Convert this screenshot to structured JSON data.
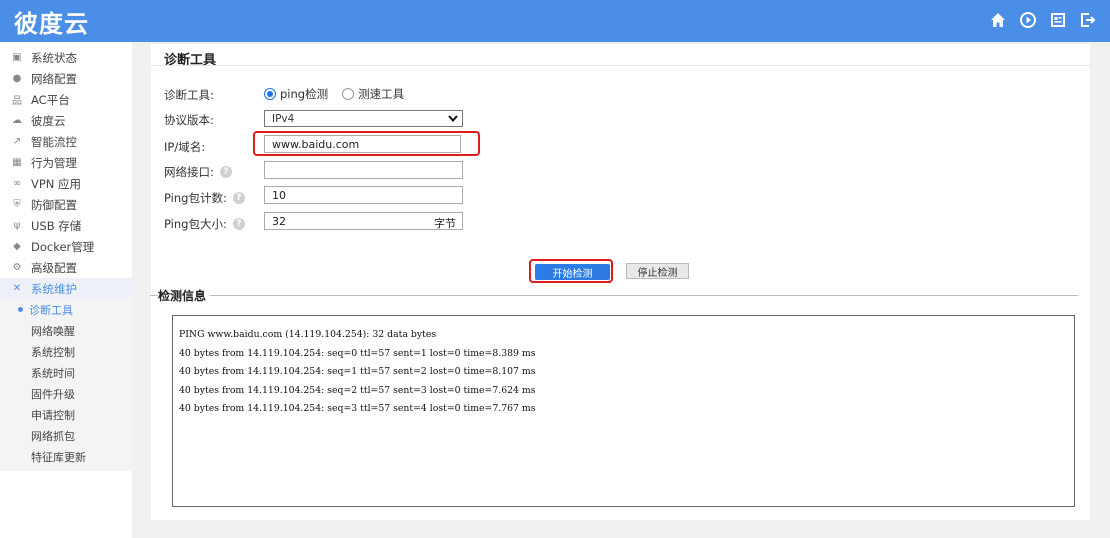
{
  "header": {
    "logo_text": "彼度云",
    "icons": [
      "home-icon",
      "play-circle-icon",
      "panel-icon",
      "logout-icon"
    ]
  },
  "sidebar": {
    "items": [
      {
        "label": "系统状态",
        "icon": "monitor-icon"
      },
      {
        "label": "网络配置",
        "icon": "globe-icon"
      },
      {
        "label": "AC平台",
        "icon": "network-tree-icon"
      },
      {
        "label": "彼度云",
        "icon": "cloud-icon"
      },
      {
        "label": "智能流控",
        "icon": "trend-icon"
      },
      {
        "label": "行为管理",
        "icon": "chart-box-icon"
      },
      {
        "label": "VPN 应用",
        "icon": "vpn-icon"
      },
      {
        "label": "防御配置",
        "icon": "shield-icon"
      },
      {
        "label": "USB 存储",
        "icon": "usb-icon"
      },
      {
        "label": "Docker管理",
        "icon": "docker-icon"
      },
      {
        "label": "高级配置",
        "icon": "gear-icon"
      },
      {
        "label": "系统维护",
        "icon": "tools-icon"
      }
    ],
    "sub_items": [
      {
        "label": "诊断工具"
      },
      {
        "label": "网络唤醒"
      },
      {
        "label": "系统控制"
      },
      {
        "label": "系统时间"
      },
      {
        "label": "固件升级"
      },
      {
        "label": "申请控制"
      },
      {
        "label": "网络抓包"
      },
      {
        "label": "特征库更新"
      }
    ]
  },
  "main": {
    "title": "诊断工具",
    "form": {
      "tool_label": "诊断工具:",
      "tool_options": [
        "ping检测",
        "测速工具"
      ],
      "tool_selected": "ping检测",
      "protocol_label": "协议版本:",
      "protocol_value": "IPv4",
      "ip_label": "IP/域名:",
      "ip_value": "www.baidu.com",
      "iface_label": "网络接口:",
      "iface_value": "",
      "count_label": "Ping包计数:",
      "count_value": "10",
      "size_label": "Ping包大小:",
      "size_value": "32",
      "size_unit": "字节"
    },
    "buttons": {
      "start": "开始检测",
      "stop": "停止检测"
    },
    "output": {
      "title": "检测信息",
      "lines": [
        "PING www.baidu.com (14.119.104.254): 32 data bytes",
        "40 bytes from 14.119.104.254: seq=0 ttl=57 sent=1 lost=0 time=8.389 ms",
        "40 bytes from 14.119.104.254: seq=1 ttl=57 sent=2 lost=0 time=8.107 ms",
        "40 bytes from 14.119.104.254: seq=2 ttl=57 sent=3 lost=0 time=7.624 ms",
        "40 bytes from 14.119.104.254: seq=3 ttl=57 sent=4 lost=0 time=7.767 ms"
      ]
    }
  },
  "colors": {
    "header_bg": "#4a8ee8",
    "accent": "#2d7ce6",
    "highlight": "#e01b1b"
  }
}
